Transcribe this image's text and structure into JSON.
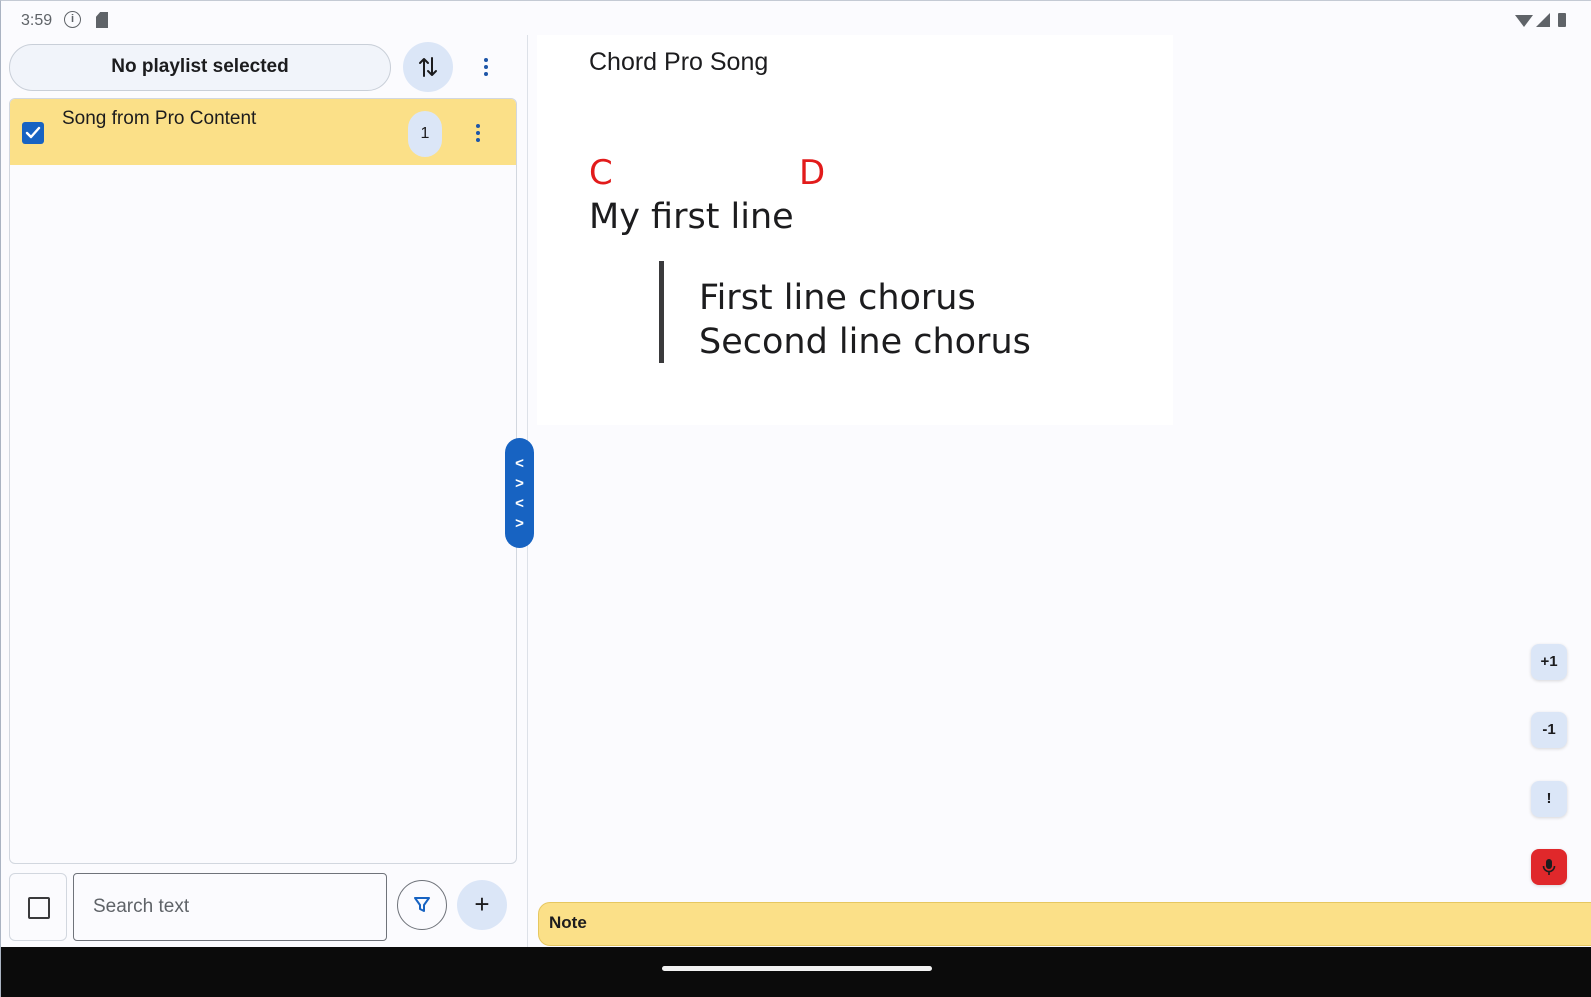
{
  "status_bar": {
    "time": "3:59",
    "info_icon": "info-icon",
    "sd_icon": "sd-card-icon"
  },
  "playlist": {
    "selected_label": "No playlist selected"
  },
  "songs": [
    {
      "title": "Song from Pro Content",
      "count": "1",
      "checked": true
    }
  ],
  "search": {
    "placeholder": "Search text",
    "value": ""
  },
  "buttons": {
    "add": "+"
  },
  "split_handle": {
    "glyphs": [
      "<",
      ">",
      "<",
      ">"
    ]
  },
  "song_view": {
    "heading": "Chord Pro Song",
    "chords": [
      "C",
      "D"
    ],
    "lyric": "My first line",
    "chorus": [
      "First line chorus",
      "Second line chorus"
    ],
    "chord_color": "#e21b1b"
  },
  "side_buttons": {
    "transpose_up": "+1",
    "transpose_down": "-1",
    "alert": "!"
  },
  "note": {
    "label": "Note"
  },
  "colors": {
    "accent": "#1763c2",
    "highlight": "#fbe088",
    "mic": "#e0282b"
  }
}
